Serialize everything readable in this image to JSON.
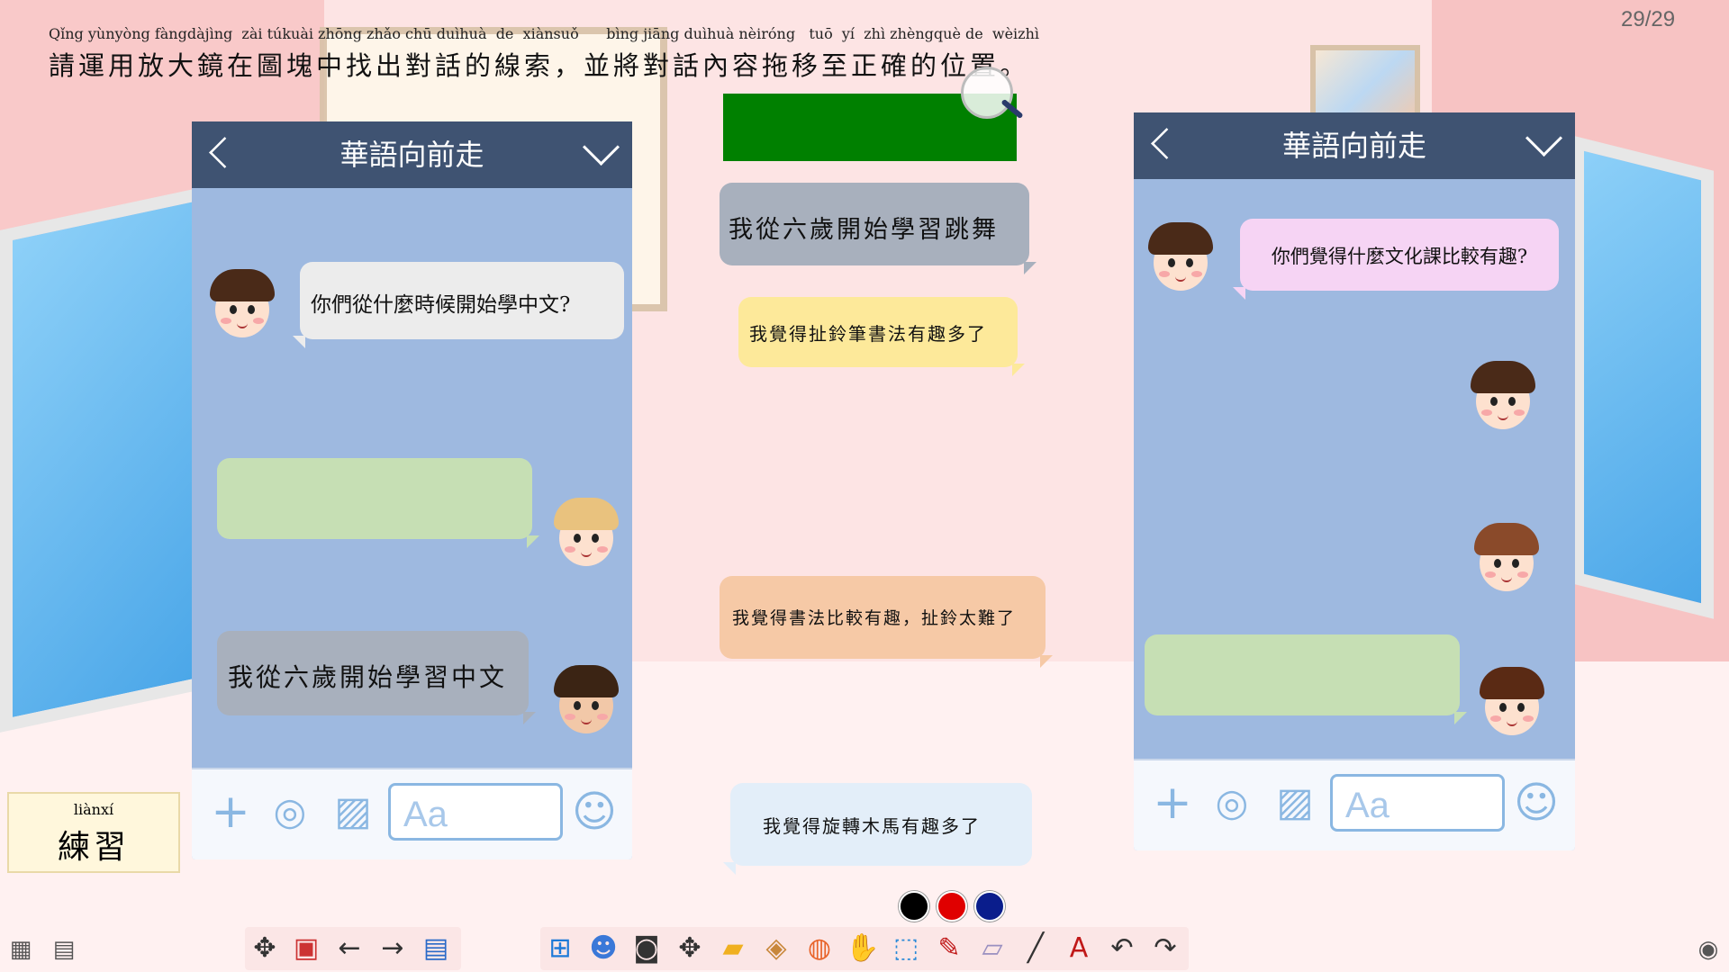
{
  "page": {
    "indicator": "29/29"
  },
  "instruction": {
    "pinyin": "Qǐng yùnyòng fàngdàjìng  zài túkuài zhōng zhǎo chū duìhuà  de  xiànsuǒ      bìng jiāng duìhuà nèiróng   tuō  yí  zhì zhèngquè de  wèizhì",
    "text": "請運用放大鏡在圖塊中找出對話的線索，並將對話內容拖移至正確的位置。"
  },
  "left_phone": {
    "title": "華語向前走",
    "back_icon": "chevron-left-icon",
    "menu_icon": "chevron-down-icon",
    "messages": [
      {
        "text": "你們從什麼時候開始學中文?"
      },
      {
        "text": ""
      },
      {
        "text": "我從六歲開始學習中文"
      }
    ],
    "input_placeholder": "Aa",
    "footer_icons": [
      "plus-icon",
      "camera-icon",
      "image-icon",
      "emoji-icon"
    ]
  },
  "right_phone": {
    "title": "華語向前走",
    "back_icon": "chevron-left-icon",
    "menu_icon": "chevron-down-icon",
    "messages": [
      {
        "text": "你們覺得什麼文化課比較有趣?"
      },
      {
        "text": ""
      }
    ],
    "input_placeholder": "Aa",
    "footer_icons": [
      "plus-icon",
      "camera-icon",
      "image-icon",
      "emoji-icon"
    ]
  },
  "draggable_bubbles": [
    {
      "text": "我從六歲開始學習跳舞"
    },
    {
      "text": "我覺得扯鈴筆書法有趣多了"
    },
    {
      "text": "我覺得書法比較有趣，扯鈴太難了"
    },
    {
      "text": "我覺得旋轉木馬有趣多了"
    }
  ],
  "practice": {
    "pinyin": "liànxí",
    "label": "練習"
  },
  "pen_colors": [
    "#000000",
    "#e00000",
    "#0a1d8c"
  ],
  "toolbar_left": [
    "move-icon",
    "whiteboard-icon",
    "prev-arrow-icon",
    "next-arrow-icon",
    "notes-icon"
  ],
  "toolbar_main": [
    "windows-icon",
    "users-icon",
    "screenshot-icon",
    "pan-icon",
    "folder-icon",
    "box-icon",
    "browser-icon",
    "hand-icon",
    "select-icon",
    "marker-icon",
    "eraser-icon",
    "line-icon",
    "text-icon",
    "undo-icon",
    "redo-icon"
  ],
  "colors": {
    "header": "#3f5372",
    "phone_body": "#9eb9e0",
    "green_block": "#008000"
  }
}
